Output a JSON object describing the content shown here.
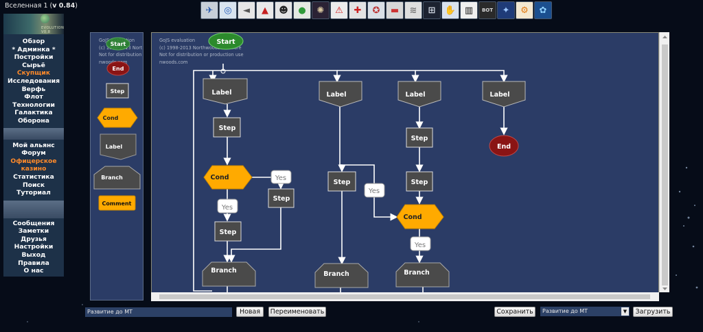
{
  "universe": {
    "label": "Вселенная 1",
    "version": "v 0.84"
  },
  "logo": {
    "text": "EVOLUTION V0.8"
  },
  "toolbar": {
    "icons": [
      {
        "name": "satellite-icon",
        "bg": "#c7cfd8",
        "glyph": "✈",
        "color": "#2255aa"
      },
      {
        "name": "target-icon",
        "bg": "#d8e3ee",
        "glyph": "◎",
        "color": "#1a56b8"
      },
      {
        "name": "megaphone-icon",
        "bg": "#e6e6e6",
        "glyph": "◄",
        "color": "#555"
      },
      {
        "name": "alert-rocket-icon",
        "bg": "#e9e9e9",
        "glyph": "▲",
        "color": "#c62020"
      },
      {
        "name": "alien-icon",
        "bg": "#e4e4e4",
        "glyph": "☻",
        "color": "#222"
      },
      {
        "name": "planet-icon",
        "bg": "#e4e9e2",
        "glyph": "●",
        "color": "#2f9a3a"
      },
      {
        "name": "galaxy-icon",
        "bg": "#2a2234",
        "glyph": "✺",
        "color": "#d8c7a0"
      },
      {
        "name": "warning-icon",
        "bg": "#ececec",
        "glyph": "⚠",
        "color": "#d21a1a"
      },
      {
        "name": "map-pin-icon",
        "bg": "#e3e3e3",
        "glyph": "✚",
        "color": "#c22"
      },
      {
        "name": "rescue-icon",
        "bg": "#d9dfe6",
        "glyph": "✪",
        "color": "#b33"
      },
      {
        "name": "fleet-icon",
        "bg": "#d7d7d7",
        "glyph": "▬",
        "color": "#c33"
      },
      {
        "name": "wifi-icon",
        "bg": "#dedede",
        "glyph": "≋",
        "color": "#777"
      },
      {
        "name": "ship-icon",
        "bg": "#1c2230",
        "glyph": "⊞",
        "color": "#cfd6e0"
      },
      {
        "name": "handshake-icon",
        "bg": "#d9e2ee",
        "glyph": "✋",
        "color": "#3a6ab0"
      },
      {
        "name": "barcode-icon",
        "bg": "#f0f0f0",
        "glyph": "▥",
        "color": "#111"
      },
      {
        "name": "bot-icon",
        "bg": "#2a2a2a",
        "glyph": "BOT",
        "color": "#d8d8d8"
      },
      {
        "name": "nebula-icon",
        "bg": "#1f3b78",
        "glyph": "✦",
        "color": "#9cc6ff"
      },
      {
        "name": "gear-icon",
        "bg": "#f3e8d0",
        "glyph": "⚙",
        "color": "#e07a12"
      },
      {
        "name": "brain-icon",
        "bg": "#1b4f8f",
        "glyph": "✿",
        "color": "#8fd1ff"
      }
    ]
  },
  "menu": {
    "group1": [
      "Обзор",
      "* Админка *",
      "Постройки",
      "Сырьё",
      "Скупщик",
      "Исследования",
      "Верфь",
      "Флот",
      "Технологии",
      "Галактика",
      "Оборона"
    ],
    "group2": [
      "Мой альянс",
      "Форум",
      "Офицерское",
      "казино",
      "Статистика",
      "Поиск",
      "Туториал"
    ],
    "group3": [
      "Сообщения",
      "Заметки",
      "Друзья",
      "Настройки",
      "Выход",
      "Правила",
      "О нас"
    ],
    "highlight": [
      "Скупщик",
      "Офицерское",
      "казино"
    ]
  },
  "palette": {
    "eval_lines": [
      "GoJS evaluation",
      "(c) 1998-2013 Nort",
      "Not for distribution",
      "nwoods.com"
    ],
    "start": "Start",
    "end": "End",
    "step": "Step",
    "cond": "Cond",
    "label": "Label",
    "branch": "Branch",
    "comment": "Comment"
  },
  "canvas": {
    "eval_lines": [
      "GoJS evaluation",
      "(c) 1998-2013 Northwoods Software",
      "Not for distribution or production use",
      "nwoods.com"
    ],
    "start": "Start",
    "end": "End",
    "label": "Label",
    "step": "Step",
    "cond": "Cond",
    "yes": "Yes",
    "branch": "Branch"
  },
  "bottom": {
    "plan_name": "Развитие до МТ",
    "new_button": "Новая",
    "rename_button": "Переименовать",
    "save_button": "Сохранить",
    "plan_select": "Развитие до МТ",
    "load_button": "Загрузить"
  },
  "colors": {
    "panel": "#2b3c66",
    "node_gray": "#4a4a4a",
    "cond_orange": "#ffaa00",
    "start_green": "#2c8a2c",
    "end_red": "#8a1414",
    "menu_orange": "#ff8a2a"
  }
}
